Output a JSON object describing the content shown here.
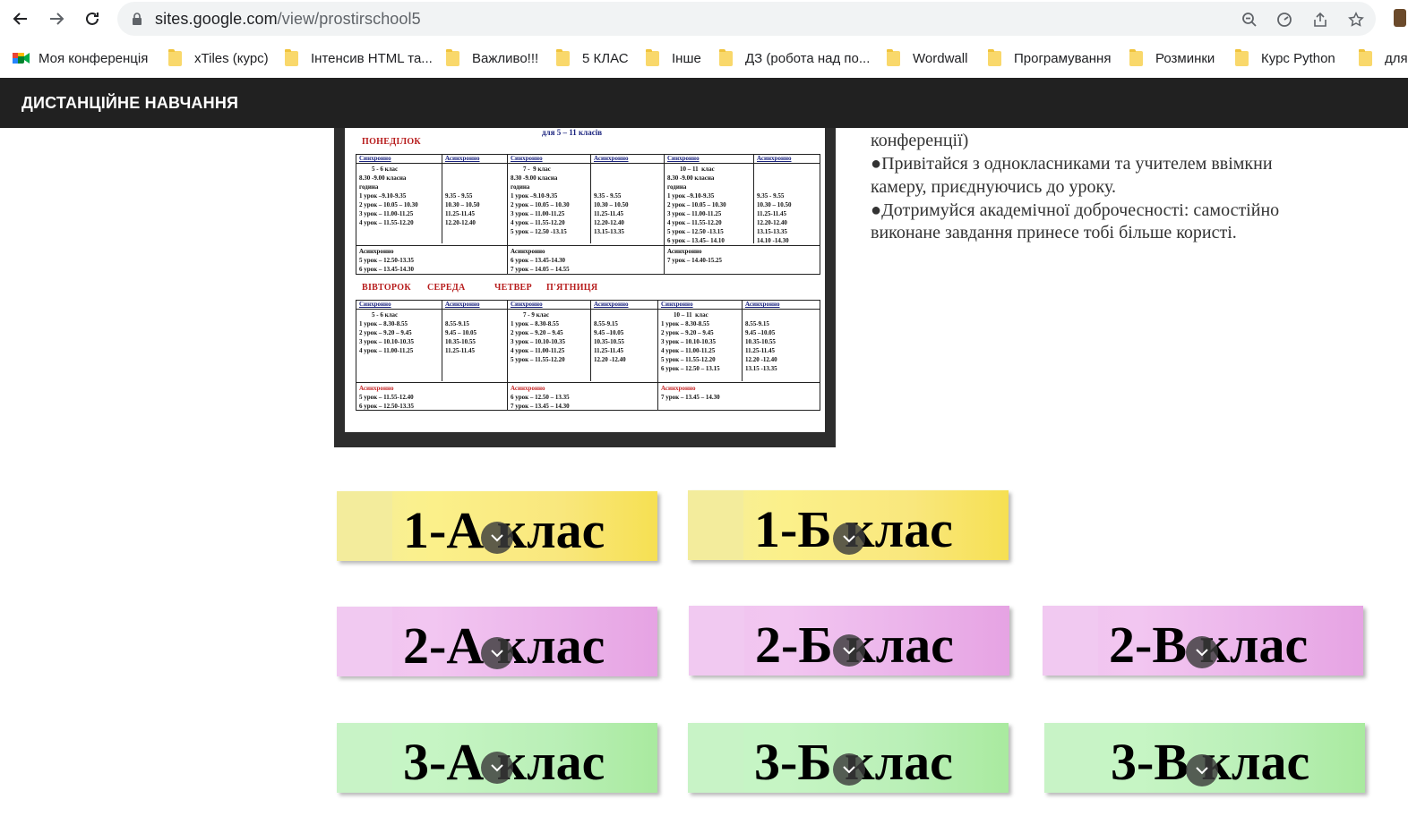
{
  "browser": {
    "url_host": "sites.google.com",
    "url_path": "/view/prostirschool5",
    "bookmarks": [
      "Моя конференція",
      "xTiles (курс)",
      "Інтенсив HTML та...",
      "Важливо!!!",
      "5 КЛАС",
      "Інше",
      "ДЗ (робота над по...",
      "Wordwall",
      "Програмування",
      "Розминки",
      "Курс Python",
      "для"
    ]
  },
  "site": {
    "title": "ДИСТАНЦІЙНЕ НАВЧАННЯ"
  },
  "schedule": {
    "caption": "для 5 – 11 класів",
    "day_monday": "ПОНЕДІЛОК",
    "days_other": [
      "ВІВТОРОК",
      "СЕРЕДА",
      "ЧЕТВЕР",
      "П'ЯТНИЦЯ"
    ],
    "sync": "Синхронно",
    "async": "Асинхронно",
    "monday": {
      "g1": "        5 - 6 клас\n8.30 -9.00 класна\nгодина\n1 урок –9.10-9.35\n2 урок – 10.05 – 10.30\n3 урок – 11.00-11.25\n4 урок – 11.55-12.20",
      "g1a": "\n\n\n9.35 - 9.55\n10.30 – 10.50\n11.25-11.45\n12.20-12.40",
      "g2": "        7 -  9 клас\n8.30 -9.00 класна\nгодина\n1 урок –9.10-9.35\n2 урок – 10.05 – 10.30\n3 урок – 11.00-11.25\n4 урок – 11.55-12.20\n5 урок – 12.50 -13.15",
      "g2a": "\n\n\n9.35 - 9.55\n10.30 – 10.50\n11.25-11.45\n12.20-12.40\n13.15-13.35",
      "g3": "        10 – 11  клас\n8.30 -9.00 класна\nгодина\n1 урок –9.10-9.35\n2 урок – 10.05 – 10.30\n3 урок – 11.00-11.25\n4 урок – 11.55-12.20\n5 урок – 12.50 -13.15\n6 урок – 13.45– 14.10",
      "g3a": "\n\n\n9.35 - 9.55\n10.30 – 10.50\n11.25-11.45\n12.20-12.40\n13.15-13.35\n14.10 -14.30",
      "b1": "Асинхронно\n5 урок – 12.50-13.35\n6 урок – 13.45-14.30",
      "b2": "Асинхронно\n6 урок – 13.45-14.30\n7 урок – 14.05 – 14.55",
      "b3": "Асинхронно\n7 урок – 14.40-15.25"
    },
    "other": {
      "g1": "        5 - 6 клас\n1 урок – 8.30-8.55\n2 урок – 9.20 – 9.45\n3 урок – 10.10-10.35\n4 урок – 11.00-11.25",
      "g1a": "\n8.55-9.15\n9.45 – 10.05\n10.35-10.55\n11.25-11.45",
      "g2": "        7 - 9 клас\n1 урок – 8.30-8.55\n2 урок – 9.20 – 9.45\n3 урок – 10.10-10.35\n4 урок – 11.00-11.25\n5 урок – 11.55-12.20",
      "g2a": "\n8.55-9.15\n9.45 –10.05\n10.35-10.55\n11.25-11.45\n12.20 -12.40",
      "g3": "        10 – 11  клас\n1 урок – 8.30-8.55\n2 урок – 9.20 – 9.45\n3 урок – 10.10-10.35\n4 урок – 11.00-11.25\n5 урок – 11.55-12.20\n6 урок – 12.50 – 13.15",
      "g3a": "\n8.55-9.15\n9.45 –10.05\n10.35-10.55\n11.25-11.45\n12.20 -12.40\n13.15 -13.35",
      "b1": "\n5 урок – 11.55-12.40\n6 урок – 12.50-13.35",
      "b2": "\n6 урок – 12.50 – 13.35\n7 урок – 13.45 – 14.30",
      "b3": "\n7 урок – 13.45 – 14.30"
    }
  },
  "intro": {
    "lines": [
      "конференції)",
      "●Привітайся з однокласниками та учителем ввімкни",
      "камеру, приєднуючись до уроку.",
      "●Дотримуйся академічної доброчесності: самостійно",
      "виконане завдання принесе тобі більше користі."
    ]
  },
  "classes": {
    "c1a": "1-А клас",
    "c1b": "1-Б клас",
    "c2a": "2-А клас",
    "c2b": "2-Б клас",
    "c2v": "2-В клас",
    "c3a": "3-А клас",
    "c3b": "3-Б клас",
    "c3v": "3-В клас"
  },
  "colors": {
    "header_bg": "#212121",
    "yellow_tile": "#f9e77d",
    "pink_tile": "#ebb3ea",
    "green_tile": "#b9efb6"
  }
}
